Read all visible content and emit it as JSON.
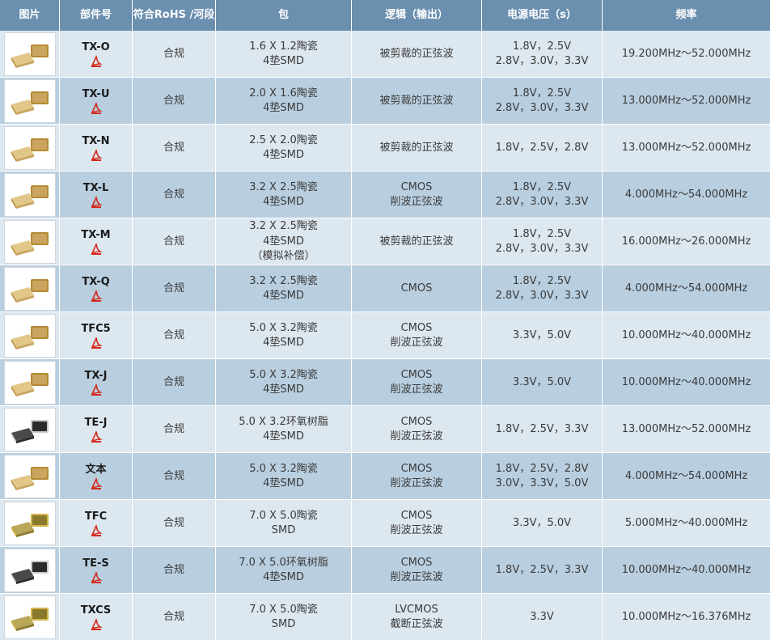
{
  "headers": {
    "image": "图片",
    "part": "部件号",
    "rohs": "符合RoHS /河段",
    "package": "包",
    "logic": "逻辑（输出）",
    "voltage": "电源电压（s）",
    "frequency": "频率"
  },
  "colors": {
    "header_bg": "#6b8faf",
    "row_odd": "#dde7ef",
    "row_even": "#b9cfe0",
    "pdf_red": "#d42a1e"
  },
  "rows": [
    {
      "part": "TX-O",
      "rohs": "合规",
      "package": [
        "1.6 X 1.2陶瓷",
        "4垫SMD"
      ],
      "logic": [
        "被剪裁的正弦波"
      ],
      "voltage": [
        "1.8V，2.5V",
        "2.8V，3.0V，3.3V"
      ],
      "frequency": "19.200MHz〜52.000MHz",
      "chip": "gold"
    },
    {
      "part": "TX-U",
      "rohs": "合规",
      "package": [
        "2.0 X 1.6陶瓷",
        "4垫SMD"
      ],
      "logic": [
        "被剪裁的正弦波"
      ],
      "voltage": [
        "1.8V，2.5V",
        "2.8V，3.0V，3.3V"
      ],
      "frequency": "13.000MHz〜52.000MHz",
      "chip": "gold"
    },
    {
      "part": "TX-N",
      "rohs": "合规",
      "package": [
        "2.5 X 2.0陶瓷",
        "4垫SMD"
      ],
      "logic": [
        "被剪裁的正弦波"
      ],
      "voltage": [
        "1.8V，2.5V，2.8V"
      ],
      "frequency": "13.000MHz〜52.000MHz",
      "chip": "gold"
    },
    {
      "part": "TX-L",
      "rohs": "合规",
      "package": [
        "3.2 X 2.5陶瓷",
        "4垫SMD"
      ],
      "logic": [
        "CMOS",
        "削波正弦波"
      ],
      "voltage": [
        "1.8V，2.5V",
        "2.8V，3.0V，3.3V"
      ],
      "frequency": "4.000MHz〜54.000MHz",
      "chip": "gold"
    },
    {
      "part": "TX-M",
      "rohs": "合规",
      "package": [
        "3.2 X 2.5陶瓷",
        "4垫SMD",
        "（模拟补偿）"
      ],
      "logic": [
        "被剪裁的正弦波"
      ],
      "voltage": [
        "1.8V，2.5V",
        "2.8V，3.0V，3.3V"
      ],
      "frequency": "16.000MHz〜26.000MHz",
      "chip": "gold"
    },
    {
      "part": "TX-Q",
      "rohs": "合规",
      "package": [
        "3.2 X 2.5陶瓷",
        "4垫SMD"
      ],
      "logic": [
        "CMOS"
      ],
      "voltage": [
        "1.8V，2.5V",
        "2.8V，3.0V，3.3V"
      ],
      "frequency": "4.000MHz〜54.000MHz",
      "chip": "gold"
    },
    {
      "part": "TFC5",
      "rohs": "合规",
      "package": [
        "5.0 X 3.2陶瓷",
        "4垫SMD"
      ],
      "logic": [
        "CMOS",
        "削波正弦波"
      ],
      "voltage": [
        "3.3V，5.0V"
      ],
      "frequency": "10.000MHz〜40.000MHz",
      "chip": "gold"
    },
    {
      "part": "TX-J",
      "rohs": "合规",
      "package": [
        "5.0 X 3.2陶瓷",
        "4垫SMD"
      ],
      "logic": [
        "CMOS",
        "削波正弦波"
      ],
      "voltage": [
        "3.3V，5.0V"
      ],
      "frequency": "10.000MHz〜40.000MHz",
      "chip": "gold"
    },
    {
      "part": "TE-J",
      "rohs": "合规",
      "package": [
        "5.0 X 3.2环氧树脂",
        "4垫SMD"
      ],
      "logic": [
        "CMOS",
        "削波正弦波"
      ],
      "voltage": [
        "1.8V，2.5V，3.3V"
      ],
      "frequency": "13.000MHz〜52.000MHz",
      "chip": "dark"
    },
    {
      "part": "文本",
      "rohs": "合规",
      "package": [
        "5.0 X 3.2陶瓷",
        "4垫SMD"
      ],
      "logic": [
        "CMOS",
        "削波正弦波"
      ],
      "voltage": [
        "1.8V，2.5V，2.8V",
        "3.0V，3.3V，5.0V"
      ],
      "frequency": "4.000MHz〜54.000MHz",
      "chip": "gold"
    },
    {
      "part": "TFC",
      "rohs": "合规",
      "package": [
        "7.0 X 5.0陶瓷",
        "SMD"
      ],
      "logic": [
        "CMOS",
        "削波正弦波"
      ],
      "voltage": [
        "3.3V，5.0V"
      ],
      "frequency": "5.000MHz〜40.000MHz",
      "chip": "olive"
    },
    {
      "part": "TE-S",
      "rohs": "合规",
      "package": [
        "7.0 X 5.0环氧树脂",
        "4垫SMD"
      ],
      "logic": [
        "CMOS",
        "削波正弦波"
      ],
      "voltage": [
        "1.8V，2.5V，3.3V"
      ],
      "frequency": "10.000MHz〜40.000MHz",
      "chip": "dark"
    },
    {
      "part": "TXCS",
      "rohs": "合规",
      "package": [
        "7.0 X 5.0陶瓷",
        "SMD"
      ],
      "logic": [
        "LVCMOS",
        "截断正弦波"
      ],
      "voltage": [
        "3.3V"
      ],
      "frequency": "10.000MHz〜16.376MHz",
      "chip": "olive"
    }
  ]
}
